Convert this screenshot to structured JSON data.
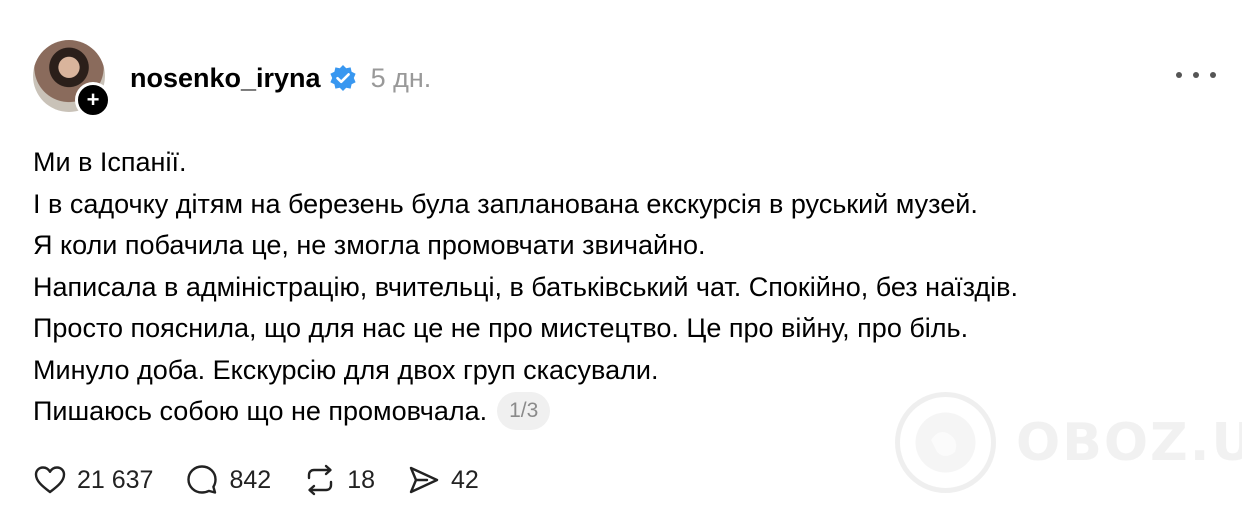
{
  "post": {
    "username": "nosenko_iryna",
    "time": "5 дн.",
    "verified": true,
    "lines": [
      "Ми в Іспанії.",
      "І в садочку дітям на березень була запланована екскурсія в руський музей.",
      "Я коли побачила це, не змогла промовчати звичайно.",
      "Написала в адміністрацію, вчительці, в батьківський чат. Спокійно, без наїздів.",
      "Просто пояснила, що для нас це не про мистецтво. Це про війну, про біль.",
      "Минуло доба. Екскурсію для двох груп скасували.",
      "Пишаюсь собою що не промовчала."
    ],
    "page_indicator": "1/3"
  },
  "actions": {
    "likes": "21 637",
    "comments": "842",
    "reposts": "18",
    "shares": "42"
  },
  "watermark": {
    "text": "OBOZ.UA"
  },
  "colors": {
    "verified": "#3897f0",
    "muted": "#999999",
    "icon": "#222222"
  }
}
